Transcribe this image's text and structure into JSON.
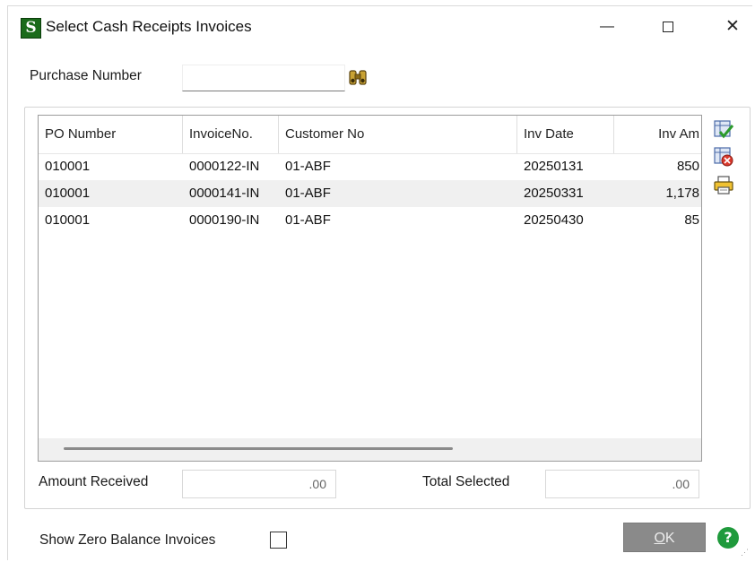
{
  "window": {
    "app_icon_letter": "S",
    "title": "Select Cash Receipts Invoices",
    "minimize": "—",
    "close": "✕"
  },
  "search": {
    "label": "Purchase Number",
    "value": ""
  },
  "grid": {
    "columns": [
      "PO Number",
      "InvoiceNo.",
      "Customer No",
      "Inv Date",
      "Inv Am"
    ],
    "rows": [
      {
        "po": "010001",
        "invoice": "0000122-IN",
        "customer": "01-ABF",
        "date": "20250131",
        "amount": "850"
      },
      {
        "po": "010001",
        "invoice": "0000141-IN",
        "customer": "01-ABF",
        "date": "20250331",
        "amount": "1,178"
      },
      {
        "po": "010001",
        "invoice": "0000190-IN",
        "customer": "01-ABF",
        "date": "20250430",
        "amount": "85"
      }
    ]
  },
  "totals": {
    "amount_received_label": "Amount Received",
    "amount_received_value": ".00",
    "total_selected_label": "Total Selected",
    "total_selected_value": ".00"
  },
  "options": {
    "show_zero_balance_label": "Show Zero Balance Invoices",
    "show_zero_balance_checked": false
  },
  "buttons": {
    "ok_mnemonic": "O",
    "ok_rest": "K",
    "help": "?"
  },
  "icons": {
    "select_all": "select-all-icon",
    "clear_all": "clear-selection-icon",
    "print": "printer-icon",
    "find": "binoculars-icon"
  },
  "colors": {
    "ok_button": "#8a8a8a",
    "help": "#1f9a3c",
    "app_icon": "#1b6b1b"
  }
}
